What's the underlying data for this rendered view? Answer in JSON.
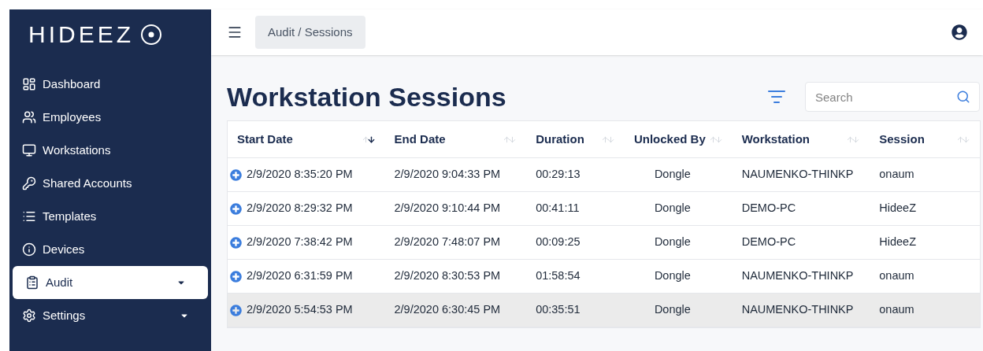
{
  "sidebar": {
    "logo": "HIDEEZ",
    "items": [
      {
        "label": "Dashboard",
        "selected": false,
        "expandable": false
      },
      {
        "label": "Employees",
        "selected": false,
        "expandable": false
      },
      {
        "label": "Workstations",
        "selected": false,
        "expandable": false
      },
      {
        "label": "Shared Accounts",
        "selected": false,
        "expandable": false
      },
      {
        "label": "Templates",
        "selected": false,
        "expandable": false
      },
      {
        "label": "Devices",
        "selected": false,
        "expandable": false
      },
      {
        "label": "Audit",
        "selected": true,
        "expandable": true
      },
      {
        "label": "Settings",
        "selected": false,
        "expandable": true
      }
    ]
  },
  "top_bar": {
    "breadcrumb": "Audit / Sessions"
  },
  "page": {
    "title": "Workstation Sessions",
    "search": {
      "placeholder": "Search"
    }
  },
  "table": {
    "columns": [
      {
        "label": "Start Date",
        "sorted": true
      },
      {
        "label": "End Date",
        "sorted": false
      },
      {
        "label": "Duration",
        "sorted": false
      },
      {
        "label": "Unlocked By",
        "sorted": false
      },
      {
        "label": "Workstation",
        "sorted": false
      },
      {
        "label": "Session",
        "sorted": false
      }
    ],
    "rows": [
      {
        "cells": [
          "2/9/2020 8:35:20 PM",
          "2/9/2020 9:04:33 PM",
          "00:29:13",
          "Dongle",
          "NAUMENKO-THINKP",
          "onaum"
        ],
        "highlighted": false
      },
      {
        "cells": [
          "2/9/2020 8:29:32 PM",
          "2/9/2020 9:10:44 PM",
          "00:41:11",
          "Dongle",
          "DEMO-PC",
          "HideeZ"
        ],
        "highlighted": false
      },
      {
        "cells": [
          "2/9/2020 7:38:42 PM",
          "2/9/2020 7:48:07 PM",
          "00:09:25",
          "Dongle",
          "DEMO-PC",
          "HideeZ"
        ],
        "highlighted": false
      },
      {
        "cells": [
          "2/9/2020 6:31:59 PM",
          "2/9/2020 8:30:53 PM",
          "01:58:54",
          "Dongle",
          "NAUMENKO-THINKP",
          "onaum"
        ],
        "highlighted": false
      },
      {
        "cells": [
          "2/9/2020 5:54:53 PM",
          "2/9/2020 6:30:45 PM",
          "00:35:51",
          "Dongle",
          "NAUMENKO-THINKP",
          "onaum"
        ],
        "highlighted": true
      }
    ]
  }
}
